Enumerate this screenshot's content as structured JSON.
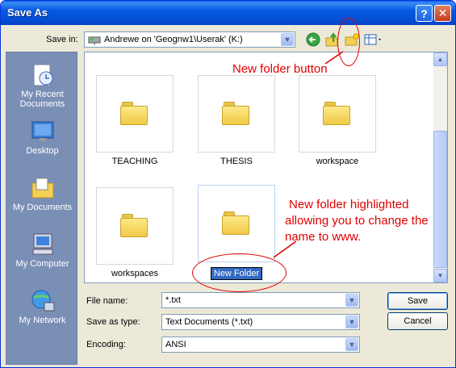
{
  "window": {
    "title": "Save As"
  },
  "save_in": {
    "label": "Save in:",
    "value": "Andrewe on 'Geognw1\\Userak' (K:)"
  },
  "places": [
    {
      "label": "My Recent Documents",
      "icon": "recent-documents-icon"
    },
    {
      "label": "Desktop",
      "icon": "desktop-icon"
    },
    {
      "label": "My Documents",
      "icon": "my-documents-icon"
    },
    {
      "label": "My Computer",
      "icon": "my-computer-icon"
    },
    {
      "label": "My Network",
      "icon": "my-network-icon"
    }
  ],
  "folders": [
    {
      "name": "TEACHING"
    },
    {
      "name": "THESIS"
    },
    {
      "name": "workspace"
    },
    {
      "name": "workspaces"
    },
    {
      "name": "New Folder",
      "editing": true
    }
  ],
  "fields": {
    "file_name": {
      "label": "File name:",
      "value": "*.txt"
    },
    "save_as_type": {
      "label": "Save as type:",
      "value": "Text Documents (*.txt)"
    },
    "encoding": {
      "label": "Encoding:",
      "value": "ANSI"
    }
  },
  "buttons": {
    "save": "Save",
    "cancel": "Cancel"
  },
  "annotations": {
    "new_folder_button": "New folder button",
    "new_folder_note_1": "New folder highlighted",
    "new_folder_note_2": "allowing you to change the",
    "new_folder_note_3": "name to www."
  },
  "colors": {
    "annotation": "#e00000",
    "titlebar": "#0451d8",
    "selection": "#316ac5"
  }
}
